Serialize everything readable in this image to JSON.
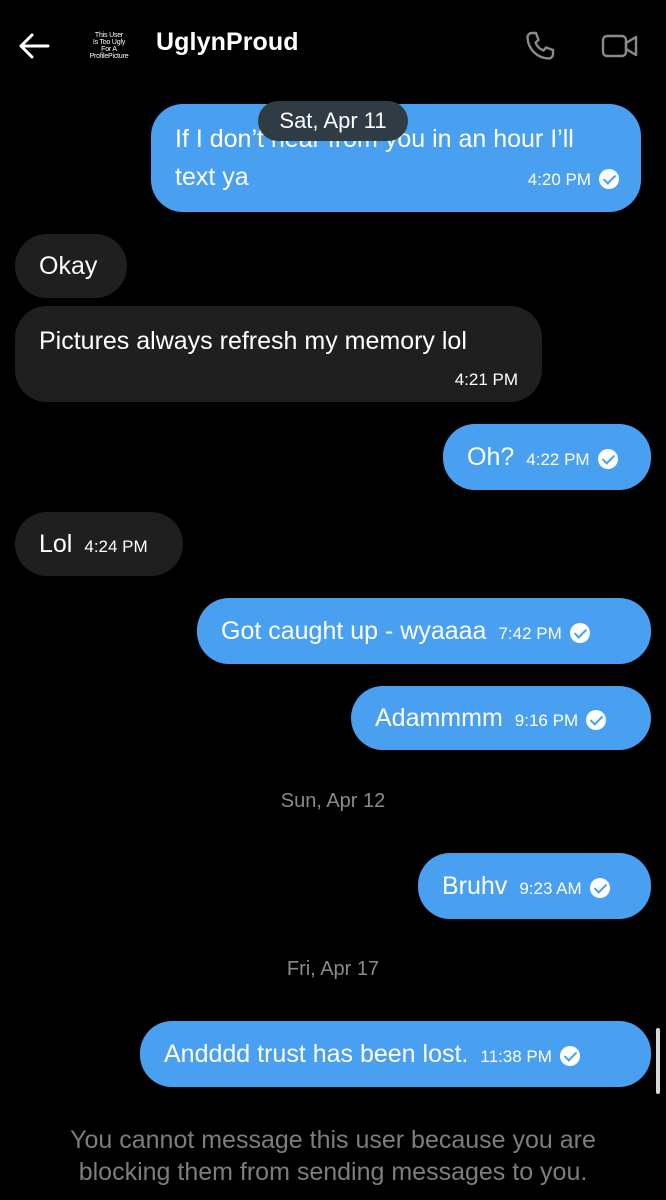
{
  "header": {
    "back_icon": "arrow-left-icon",
    "avatar_lines": [
      "This User",
      "Is Too Ugly",
      "For A",
      "ProfilePicture"
    ],
    "contact_name": "UglynProud",
    "phone_icon": "phone-icon",
    "video_icon": "video-camera-icon"
  },
  "floating_date": "Sat, Apr 11",
  "messages": [
    {
      "id": "m1",
      "dir": "out",
      "text_line1": "If I don’t hear from you in an hour I’ll",
      "text_line2": "text ya",
      "time": "4:20 PM",
      "read": true
    },
    {
      "id": "m2",
      "dir": "in",
      "text": "Okay"
    },
    {
      "id": "m3",
      "dir": "in",
      "text": "Pictures always refresh my memory lol",
      "time": "4:21 PM"
    },
    {
      "id": "m4",
      "dir": "out",
      "text": "Oh?",
      "time": "4:22 PM",
      "read": true
    },
    {
      "id": "m5",
      "dir": "in",
      "text": "Lol",
      "time": "4:24 PM"
    },
    {
      "id": "m6",
      "dir": "out",
      "text": "Got caught up - wyaaaa",
      "time": "7:42 PM",
      "read": true
    },
    {
      "id": "m7",
      "dir": "out",
      "text": "Adammmm",
      "time": "9:16 PM",
      "read": true
    },
    {
      "id": "m8",
      "dir": "out",
      "text": "Bruhv",
      "time": "9:23 AM",
      "read": true
    },
    {
      "id": "m9",
      "dir": "out",
      "text": "Andddd trust has been lost.",
      "time": "11:38 PM",
      "read": true
    }
  ],
  "date_separators": {
    "sun": "Sun, Apr 12",
    "fri": "Fri, Apr 17"
  },
  "notice": "You cannot message this user because you are blocking them from sending messages to you.",
  "colors": {
    "outgoing_bubble": "#4aa0f0",
    "incoming_bubble": "#1f1f1f",
    "background": "#000000",
    "muted_text": "#7d7d7d"
  }
}
